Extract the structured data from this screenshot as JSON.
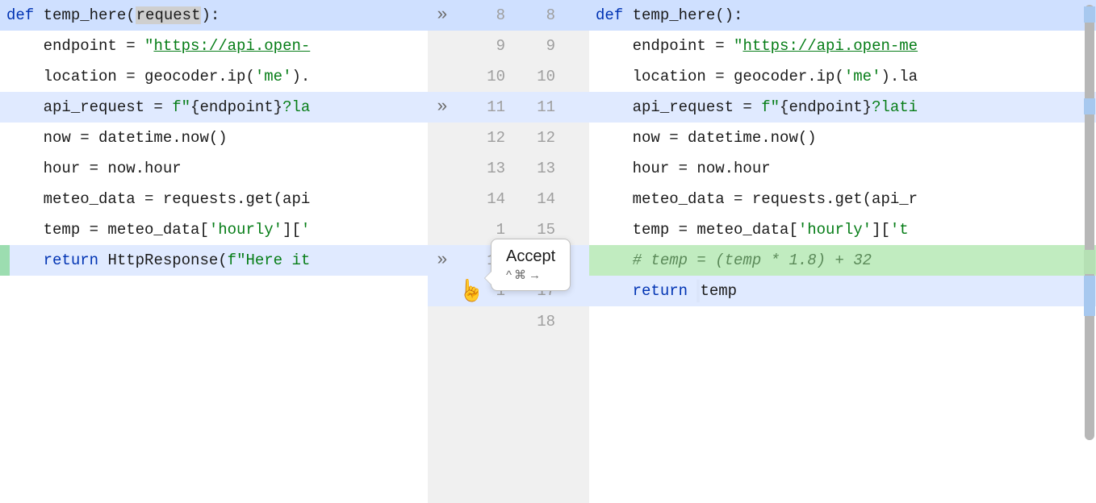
{
  "left": {
    "lines": [
      {
        "n": 8,
        "kind": "blue",
        "chev": true,
        "html": "<span class='kw'>def</span> <span class='fn'>temp_here</span>(<span class='param-bg'>request</span>):"
      },
      {
        "n": 9,
        "kind": "plain",
        "chev": false,
        "html": "    endpoint = <span class='str'>\"</span><span class='str-und'>https://api.open-</span>"
      },
      {
        "n": 10,
        "kind": "plain",
        "chev": false,
        "html": "    location = geocoder.ip(<span class='str'>'me'</span>)."
      },
      {
        "n": 11,
        "kind": "blue2",
        "chev": true,
        "html": "    api_request = <span class='str'>f\"</span>{endpoint}<span class='str'>?la</span>"
      },
      {
        "n": 12,
        "kind": "plain",
        "chev": false,
        "html": "    now = datetime.now()"
      },
      {
        "n": 13,
        "kind": "plain",
        "chev": false,
        "html": "    hour = now.hour"
      },
      {
        "n": 14,
        "kind": "plain",
        "chev": false,
        "html": "    meteo_data = requests.get(api"
      },
      {
        "n": 15,
        "kind": "plain",
        "chev": false,
        "html": "    temp = meteo_data[<span class='str'>'hourly'</span>][<span class='str'>'</span>"
      },
      {
        "n": 16,
        "kind": "blueL",
        "chev": true,
        "html": "    <span class='kw'>return</span> <span class='fn'>HttpResponse</span>(<span class='str'>f\"Here it</span>"
      }
    ]
  },
  "right": {
    "lines": [
      {
        "n": 8,
        "kind": "blue",
        "html": "<span class='kw'>def</span> <span class='fn'>temp_here</span>():"
      },
      {
        "n": 9,
        "kind": "plain",
        "html": "    endpoint = <span class='str'>\"</span><span class='str-und'>https://api.open-me</span>"
      },
      {
        "n": 10,
        "kind": "plain",
        "html": "    location = geocoder.ip(<span class='str'>'me'</span>).la"
      },
      {
        "n": 11,
        "kind": "blue2",
        "html": "    api_request = <span class='str'>f\"</span>{endpoint}<span class='str'>?lati</span>"
      },
      {
        "n": 12,
        "kind": "plain",
        "html": "    now = datetime.now()"
      },
      {
        "n": 13,
        "kind": "plain",
        "html": "    hour = now.hour"
      },
      {
        "n": 14,
        "kind": "plain",
        "html": "    meteo_data = requests.get(api_r"
      },
      {
        "n": 15,
        "kind": "plain",
        "html": "    temp = meteo_data[<span class='str'>'hourly'</span>][<span class='str'>'t</span>"
      },
      {
        "n": 16,
        "kind": "green",
        "html": "    <span class='comment'># temp = (temp * 1.8) + 32</span>"
      },
      {
        "n": 17,
        "kind": "blue2",
        "html": "    <span class='kw'>return</span> <span class='code-caret'></span>temp"
      },
      {
        "n": 18,
        "kind": "plain",
        "html": ""
      }
    ]
  },
  "popup": {
    "label": "Accept",
    "shortcut": "^⌘→"
  },
  "chevrons_glyph": "»"
}
